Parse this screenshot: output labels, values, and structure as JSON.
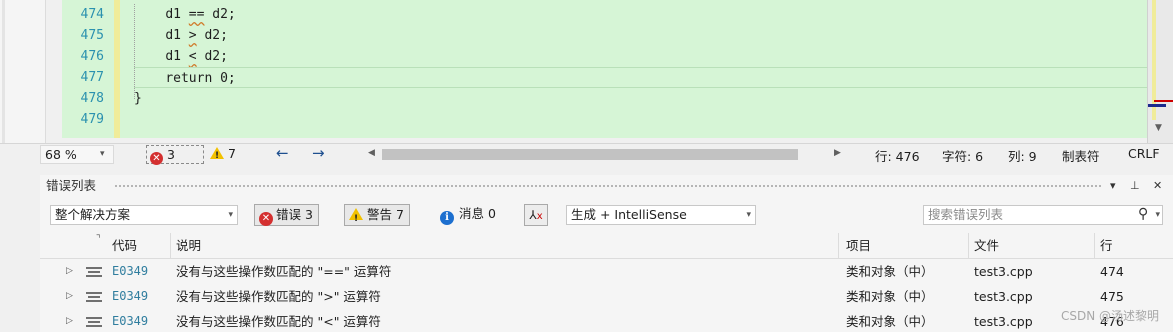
{
  "editor": {
    "line_numbers": [
      "474",
      "475",
      "476",
      "477",
      "478",
      "479"
    ],
    "code_lines": [
      {
        "indent": "    ",
        "pre": "d1 ",
        "op": "==",
        "post": " d2;"
      },
      {
        "indent": "    ",
        "pre": "d1 ",
        "op": ">",
        "post": " d2;"
      },
      {
        "indent": "    ",
        "pre": "d1 ",
        "op": "<",
        "post": " d2;"
      },
      {
        "indent": "    ",
        "pre": "return 0;",
        "op": "",
        "post": ""
      },
      {
        "indent": "",
        "pre": "}",
        "op": "",
        "post": ""
      },
      {
        "indent": "",
        "pre": "",
        "op": "",
        "post": ""
      }
    ],
    "background_color": "#d6f5d6"
  },
  "status_bar": {
    "zoom": "68 %",
    "error_count": "3",
    "warning_count": "7",
    "line": "行: 476",
    "char": "字符: 6",
    "col": "列: 9",
    "tabs": "制表符",
    "eol": "CRLF"
  },
  "error_list": {
    "title": "错误列表",
    "scope": "整个解决方案",
    "errors_btn": "错误 3",
    "warnings_btn": "警告 7",
    "messages_btn": "消息 0",
    "build_source": "生成 + IntelliSense",
    "search_placeholder": "搜索错误列表",
    "columns": {
      "code": "代码",
      "description": "说明",
      "project": "项目",
      "file": "文件",
      "line": "行"
    },
    "rows": [
      {
        "code": "E0349",
        "description": "没有与这些操作数匹配的 \"==\" 运算符",
        "project": "类和对象（中）",
        "file": "test3.cpp",
        "line": "474"
      },
      {
        "code": "E0349",
        "description": "没有与这些操作数匹配的 \">\" 运算符",
        "project": "类和对象（中）",
        "file": "test3.cpp",
        "line": "475"
      },
      {
        "code": "E0349",
        "description": "没有与这些操作数匹配的 \"<\" 运算符",
        "project": "类和对象（中）",
        "file": "test3.cpp",
        "line": "476"
      }
    ]
  },
  "watermark": "CSDN @汤述黎明"
}
